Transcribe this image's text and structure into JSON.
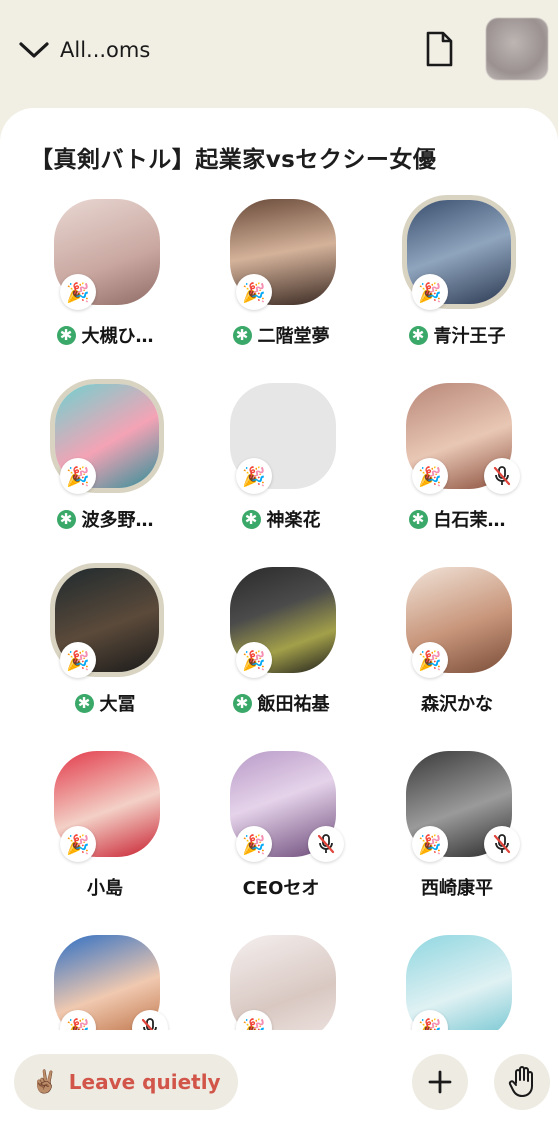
{
  "header": {
    "rooms_label": "All...oms"
  },
  "room": {
    "title": "【真剣バトル】起業家vsセクシー女優"
  },
  "speakers": [
    {
      "name": "大槻ひ…",
      "moderator": true,
      "muted": false,
      "ring": false,
      "bg": "linear-gradient(160deg,#e9d7d2,#c9a7a0 60%,#8f6b66)"
    },
    {
      "name": "二階堂夢",
      "moderator": true,
      "muted": false,
      "ring": false,
      "bg": "linear-gradient(170deg,#6a4b3a,#d4b29a 50%,#3b2a23)"
    },
    {
      "name": "青汁王子",
      "moderator": true,
      "muted": false,
      "ring": true,
      "bg": "linear-gradient(160deg,#3a4f6e,#8fa4bd 50%,#2c3a52)"
    },
    {
      "name": "波多野…",
      "moderator": true,
      "muted": false,
      "ring": true,
      "bg": "linear-gradient(150deg,#6fd1d0,#f4a3b5 55%,#2d8f98)"
    },
    {
      "name": "神楽花",
      "moderator": true,
      "muted": false,
      "ring": false,
      "bg": "#e6e6e6"
    },
    {
      "name": "白石茉…",
      "moderator": true,
      "muted": true,
      "ring": false,
      "bg": "linear-gradient(160deg,#b88778,#e9c7b5 55%,#8a4f3c)"
    },
    {
      "name": "大冨",
      "moderator": true,
      "muted": false,
      "ring": true,
      "bg": "linear-gradient(160deg,#1f2a2e,#5b4a3a 55%,#1a1a1a)"
    },
    {
      "name": "飯田祐基",
      "moderator": true,
      "muted": false,
      "ring": false,
      "bg": "linear-gradient(160deg,#2a2a2a,#4b4b4b 40%,#a3a04a 70%,#1b1b1b)"
    },
    {
      "name": "森沢かな",
      "moderator": false,
      "muted": false,
      "ring": false,
      "bg": "linear-gradient(160deg,#f1e3d8,#c8967b 55%,#7a4c38)"
    },
    {
      "name": "小島",
      "moderator": false,
      "muted": false,
      "ring": false,
      "bg": "linear-gradient(160deg,#e23a4a,#f3d0c6 55%,#c81f2f)"
    },
    {
      "name": "CEOセオ",
      "moderator": false,
      "muted": true,
      "ring": false,
      "bg": "linear-gradient(160deg,#b89ac7,#e5d3ea 45%,#6c4a79)"
    },
    {
      "name": "西崎康平",
      "moderator": false,
      "muted": true,
      "ring": false,
      "bg": "linear-gradient(160deg,#3a3a3a,#9a9a9a 55%,#2a2a2a)"
    },
    {
      "name": "",
      "moderator": false,
      "muted": true,
      "ring": false,
      "bg": "linear-gradient(160deg,#2f6fc4,#f0c9b0 55%,#b96a3d)"
    },
    {
      "name": "",
      "moderator": false,
      "muted": false,
      "ring": false,
      "bg": "linear-gradient(160deg,#f4efee,#d9c8c2 60%,#efe5e2)"
    },
    {
      "name": "",
      "moderator": false,
      "muted": false,
      "ring": false,
      "bg": "linear-gradient(160deg,#8fd6e0,#dff1f3 55%,#6ec3cf)"
    }
  ],
  "footer": {
    "leave_label": "Leave quietly",
    "leave_emoji": "✌🏽"
  },
  "colors": {
    "background": "#f1eee4",
    "leave_text": "#d2554a",
    "moderator": "#3aa868"
  }
}
